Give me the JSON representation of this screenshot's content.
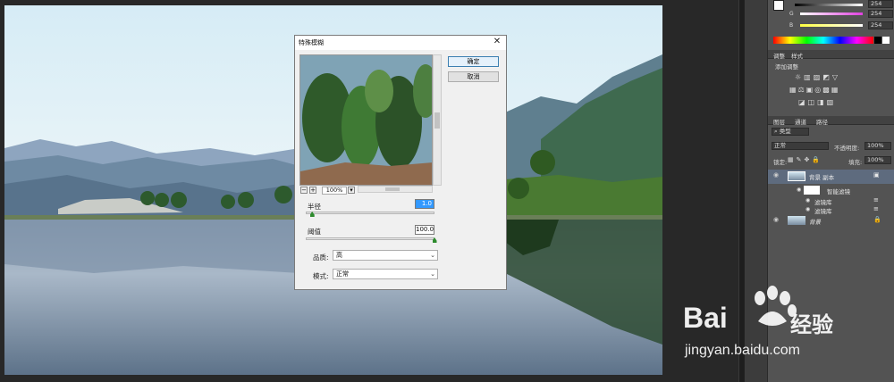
{
  "dialog": {
    "title": "特殊模糊",
    "ok_label": "确定",
    "cancel_label": "取消",
    "zoom_value": "100%",
    "radius_label": "半径",
    "radius_value": "1.0",
    "radius_fraction": 0.05,
    "threshold_label": "阈值",
    "threshold_value": "100.0",
    "threshold_fraction": 1.0,
    "quality_label": "品质:",
    "quality_value": "高",
    "mode_label": "模式:",
    "mode_value": "正常"
  },
  "color_panel": {
    "r_value": "254",
    "g_value": "254",
    "b_value": "254",
    "g_label": "G",
    "b_label": "B"
  },
  "adjust_panel": {
    "tab_adjust": "调整",
    "tab_style": "样式",
    "add_label": "添加调整"
  },
  "layers_panel": {
    "tab_layers": "图层",
    "tab_channels": "通道",
    "tab_paths": "路径",
    "kind_label": "类型",
    "blend_mode": "正常",
    "opacity_label": "不透明度:",
    "opacity_value": "100%",
    "lock_label": "锁定:",
    "fill_label": "填充:",
    "fill_value": "100%",
    "layers": [
      {
        "name": "背景 副本"
      },
      {
        "name": "智能滤镜"
      },
      {
        "name": "滤镜库"
      },
      {
        "name": "滤镜库"
      },
      {
        "name": "背景"
      }
    ]
  },
  "watermark": {
    "brand": "Bai",
    "brand2": "经验",
    "url": "jingyan.baidu.com"
  }
}
